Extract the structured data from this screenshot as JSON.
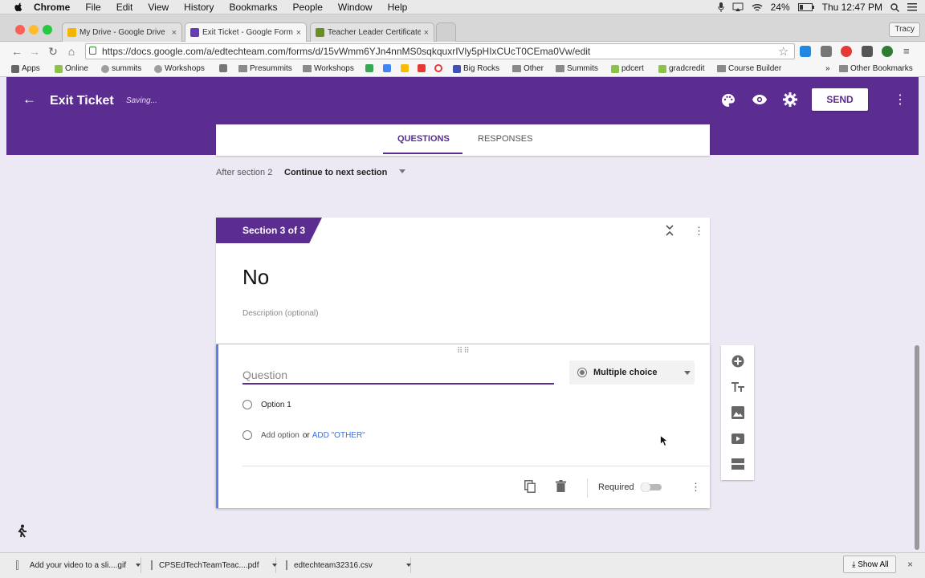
{
  "menubar": {
    "items": [
      "Chrome",
      "File",
      "Edit",
      "View",
      "History",
      "Bookmarks",
      "People",
      "Window",
      "Help"
    ],
    "battery": "24%",
    "clock": "Thu 12:47 PM"
  },
  "tabs": [
    {
      "label": "My Drive - Google Drive",
      "favicon_color": "#f4b400"
    },
    {
      "label": "Exit Ticket - Google Forms",
      "favicon_color": "#673ab7"
    },
    {
      "label": "Teacher Leader Certificate",
      "favicon_color": "#6b8e23"
    }
  ],
  "profile": "Tracy",
  "address": {
    "url": "https://docs.google.com/a/edtechteam.com/forms/d/15vWmm6YJn4nnMS0sqkquxrIVly5pHIxCUcT0CEma0Vw/edit"
  },
  "bookmarks": [
    {
      "label": "Apps",
      "icon": "apps-grid-icon"
    },
    {
      "label": "Online",
      "icon": "leaf-icon"
    },
    {
      "label": "summits",
      "icon": "smiley-icon"
    },
    {
      "label": "Workshops",
      "icon": "smiley-icon"
    },
    {
      "label": "",
      "icon": "pencil-icon"
    },
    {
      "label": "Presummits",
      "icon": "folder-icon"
    },
    {
      "label": "Workshops",
      "icon": "folder-icon"
    },
    {
      "label": "",
      "icon": "drive-icon"
    },
    {
      "label": "",
      "icon": "drive-icon"
    },
    {
      "label": "",
      "icon": "keep-icon"
    },
    {
      "label": "",
      "icon": "red-square-icon"
    },
    {
      "label": "",
      "icon": "target-icon"
    },
    {
      "label": "Big Rocks",
      "icon": "list-icon"
    },
    {
      "label": "Other",
      "icon": "folder-icon"
    },
    {
      "label": "Summits",
      "icon": "folder-icon"
    },
    {
      "label": "pdcert",
      "icon": "leaf-icon"
    },
    {
      "label": "gradcredit",
      "icon": "leaf-icon"
    },
    {
      "label": "Course Builder",
      "icon": "folder-icon"
    }
  ],
  "other_bookmarks": "Other Bookmarks",
  "form": {
    "title": "Exit Ticket",
    "status": "Saving...",
    "send_label": "SEND",
    "tabs": {
      "questions": "QUESTIONS",
      "responses": "RESPONSES"
    },
    "after_section_label": "After section 2",
    "after_section_value": "Continue to next section",
    "section_badge": "Section 3 of 3",
    "section_title": "No",
    "section_description": "Description (optional)",
    "question_placeholder": "Question",
    "question_type": "Multiple choice",
    "options": [
      "Option 1"
    ],
    "add_option": "Add option",
    "or_text": "or",
    "add_other": "ADD \"OTHER\"",
    "required_label": "Required",
    "required": false
  },
  "colors": {
    "accent": "#5c2d91",
    "background": "#ede9f4",
    "link": "#3f6fd8"
  },
  "downloads": [
    {
      "label": "Add your video to a sli....gif"
    },
    {
      "label": "CPSEdTechTeamTeac....pdf"
    },
    {
      "label": "edtechteam32316.csv"
    }
  ],
  "show_all": "Show All"
}
